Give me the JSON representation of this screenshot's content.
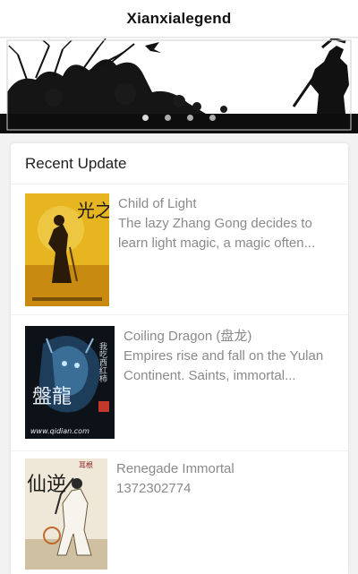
{
  "app": {
    "title": "Xianxialegend"
  },
  "banner": {
    "slides": 4,
    "active_slide": 1
  },
  "recent": {
    "heading": "Recent Update",
    "items": [
      {
        "title": "Child of Light",
        "desc": "The lazy Zhang Gong decides to learn light magic, a magic often..."
      },
      {
        "title": "Coiling Dragon (盘龙)",
        "desc": "Empires rise and fall on the Yulan Continent. Saints, immortal..."
      },
      {
        "title": "Renegade Immortal",
        "desc": "1372302774"
      }
    ]
  },
  "covers": {
    "c1": {
      "big": "光之子"
    },
    "c2": {
      "big": "盤龍",
      "side": "我吃西红柿",
      "url": "www.qidian.com"
    },
    "c3": {
      "big": "仙逆",
      "side": "耳根"
    }
  }
}
